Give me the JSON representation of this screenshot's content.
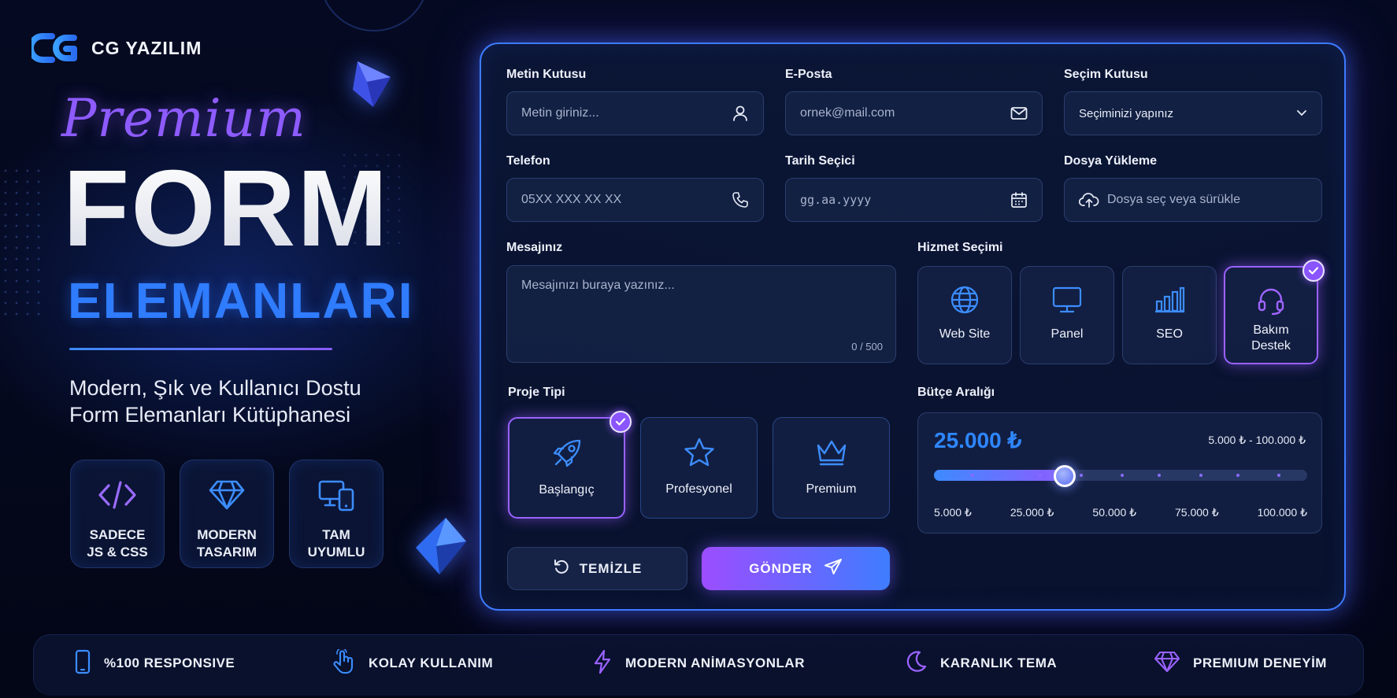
{
  "brand": {
    "name": "CG YAZILIM",
    "logo": "cg-logo"
  },
  "hero": {
    "premium": "Premium",
    "title": "FORM",
    "subtitle_word": "ELEMANLARI",
    "tagline_line1": "Modern, Şık ve Kullanıcı Dostu",
    "tagline_line2": "Form Elemanları Kütüphanesi"
  },
  "features": [
    {
      "icon": "code-icon",
      "label": "SADECE\nJS & CSS"
    },
    {
      "icon": "diamond-icon",
      "label": "MODERN\nTASARIM"
    },
    {
      "icon": "devices-icon",
      "label": "TAM\nUYUMLU"
    }
  ],
  "form": {
    "text_box": {
      "label": "Metin Kutusu",
      "placeholder": "Metin giriniz...",
      "icon": "user-icon"
    },
    "email": {
      "label": "E-Posta",
      "placeholder": "ornek@mail.com",
      "icon": "mail-icon"
    },
    "select": {
      "label": "Seçim Kutusu",
      "value": "Seçiminizi yapınız",
      "icon": "chevron-down-icon"
    },
    "phone": {
      "label": "Telefon",
      "placeholder": "05XX XXX XX XX",
      "icon": "phone-icon"
    },
    "date": {
      "label": "Tarih Seçici",
      "placeholder": "gg.aa.yyyy",
      "icon": "calendar-icon"
    },
    "file": {
      "label": "Dosya Yükleme",
      "placeholder": "Dosya seç veya sürükle",
      "icon": "cloud-upload-icon"
    },
    "message": {
      "label": "Mesajınız",
      "placeholder": "Mesajınızı buraya yazınız...",
      "counter": "0 / 500"
    },
    "services": {
      "label": "Hizmet Seçimi",
      "items": [
        {
          "icon": "globe-icon",
          "label": "Web Site",
          "selected": false
        },
        {
          "icon": "monitor-icon",
          "label": "Panel",
          "selected": false
        },
        {
          "icon": "bar-chart-icon",
          "label": "SEO",
          "selected": false
        },
        {
          "icon": "headset-icon",
          "label": "Bakım\nDestek",
          "selected": true
        }
      ]
    },
    "project_type": {
      "label": "Proje Tipi",
      "items": [
        {
          "icon": "rocket-icon",
          "label": "Başlangıç",
          "selected": true
        },
        {
          "icon": "star-icon",
          "label": "Profesyonel",
          "selected": false
        },
        {
          "icon": "crown-icon",
          "label": "Premium",
          "selected": false
        }
      ]
    },
    "budget": {
      "label": "Bütçe Aralığı",
      "value": "25.000 ₺",
      "range": "5.000 ₺ - 100.000 ₺",
      "slider_fraction": 0.35,
      "tick_labels": [
        "5.000 ₺",
        "25.000 ₺",
        "50.000 ₺",
        "75.000 ₺",
        "100.000 ₺"
      ]
    },
    "clear_button": "TEMİZLE",
    "send_button": "GÖNDER"
  },
  "bottom_bar": [
    {
      "icon": "smartphone-icon",
      "label": "%100 RESPONSIVE"
    },
    {
      "icon": "pointer-hand-icon",
      "label": "KOLAY KULLANIM"
    },
    {
      "icon": "lightning-icon",
      "label": "MODERN ANİMASYONLAR"
    },
    {
      "icon": "moon-icon",
      "label": "KARANLIK TEMA"
    },
    {
      "icon": "diamond-icon",
      "label": "PREMIUM DENEYİM"
    }
  ],
  "colors": {
    "accent_blue": "#2f7cff",
    "accent_purple": "#8d5bff",
    "background": "#050a22"
  }
}
